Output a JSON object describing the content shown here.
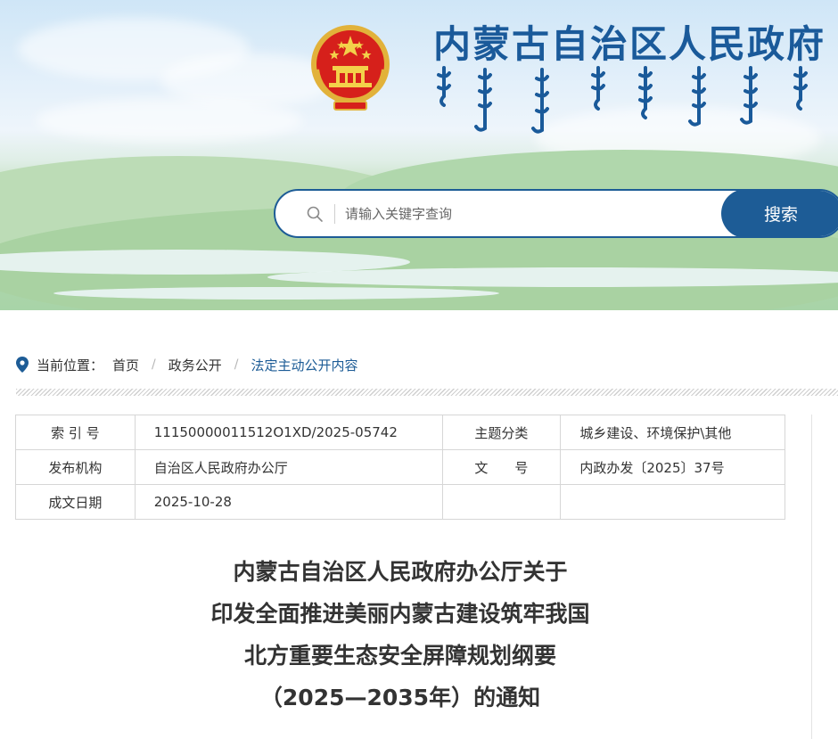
{
  "header": {
    "site_title": "内蒙古自治区人民政府",
    "emblem": "national-emblem",
    "mongolian_title": "mongolian-script-title"
  },
  "search": {
    "placeholder": "请输入关键字查询",
    "button_label": "搜索",
    "icon": "search-icon"
  },
  "breadcrumb": {
    "icon": "location-pin-icon",
    "label": "当前位置：",
    "items": [
      "首页",
      "政务公开",
      "法定主动公开内容"
    ]
  },
  "info_table": {
    "rows": [
      {
        "k1": "索 引 号",
        "v1": "11150000011512O1XD/2025-05742",
        "k2": "主题分类",
        "v2": "城乡建设、环境保护\\其他"
      },
      {
        "k1": "发布机构",
        "v1": "自治区人民政府办公厅",
        "k2": "文　　号",
        "v2": "内政办发〔2025〕37号"
      },
      {
        "k1": "成文日期",
        "v1": "2025-10-28",
        "k2": "",
        "v2": ""
      }
    ]
  },
  "document": {
    "title_lines": [
      "内蒙古自治区人民政府办公厅关于",
      "印发全面推进美丽内蒙古建设筑牢我国",
      "北方重要生态安全屏障规划纲要",
      "（2025—2035年）的通知"
    ]
  },
  "colors": {
    "brand": "#1d5c96",
    "title": "#1a5a9a",
    "border": "#d6d6d6"
  }
}
